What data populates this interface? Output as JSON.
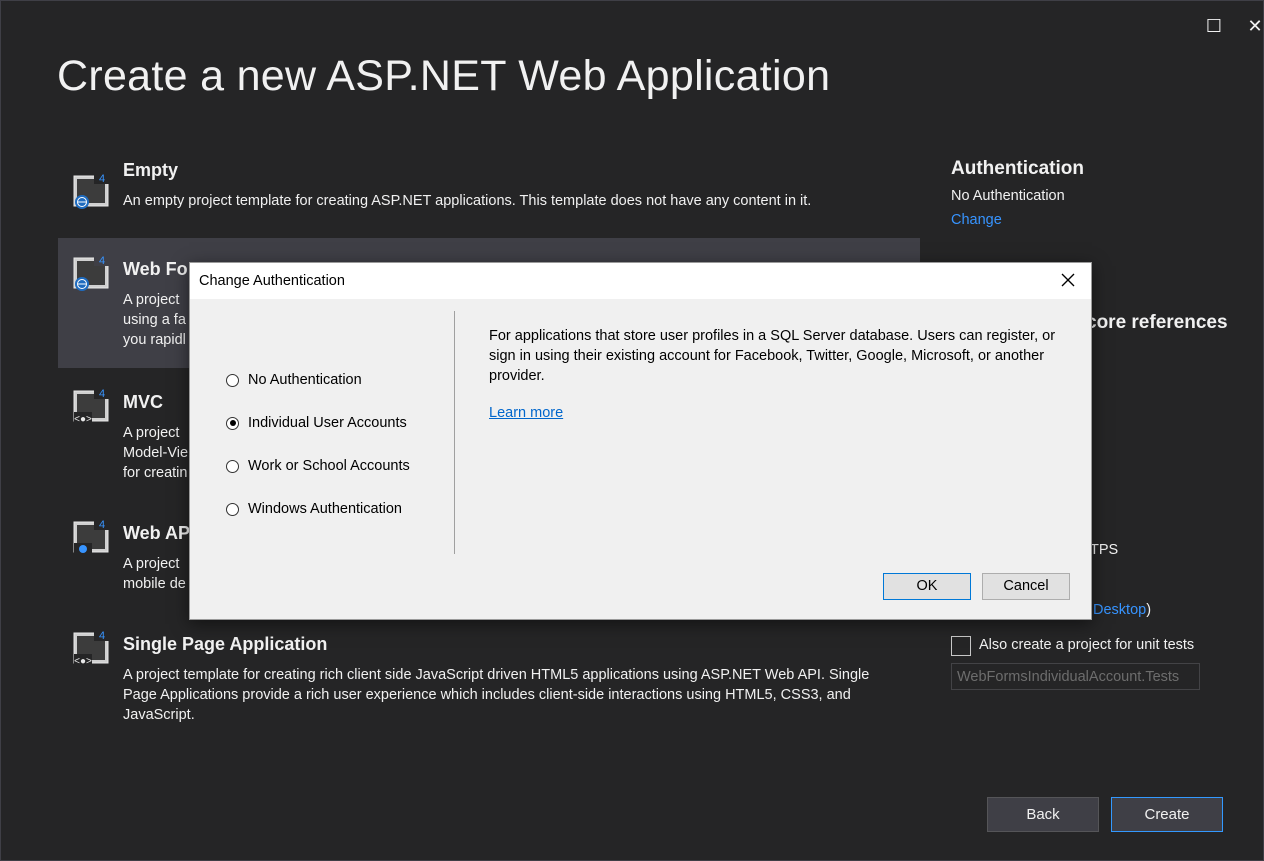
{
  "page": {
    "title": "Create a new ASP.NET Web Application"
  },
  "window_controls": {
    "maximize_glyph": "☐",
    "close_glyph": "✕"
  },
  "templates": [
    {
      "name": "Empty",
      "description": "An empty project template for creating ASP.NET applications. This template does not have any content in it.",
      "icon": "web-forms-icon"
    },
    {
      "name": "Web Fo",
      "description": "A project using a fa you rapidl",
      "desc_lines": [
        "A project",
        "using a fa",
        "you rapidl"
      ],
      "icon": "web-forms-icon",
      "selected": true
    },
    {
      "name": "MVC",
      "desc_lines": [
        "A project",
        "Model-Vie",
        "for creatin"
      ],
      "icon": "mvc-icon"
    },
    {
      "name": "Web AP",
      "desc_lines": [
        "A project",
        "mobile de"
      ],
      "icon": "web-api-icon"
    },
    {
      "name": "Single Page Application",
      "description": "A project template for creating rich client side JavaScript driven HTML5 applications using ASP.NET Web API. Single Page Applications provide a rich user experience which includes client-side interactions using HTML5, CSS3, and JavaScript.",
      "icon": "spa-icon"
    }
  ],
  "right_panel": {
    "auth_heading": "Authentication",
    "auth_value": "No Authentication",
    "change_link": "Change",
    "core_refs_fragment": "core references",
    "https_fragment": "TPS",
    "desktop_link": "Desktop",
    "desktop_paren": ")",
    "unit_tests_label": "Also create a project for unit tests",
    "unit_tests_checked": false,
    "tests_project_name": "WebFormsIndividualAccount.Tests"
  },
  "footer": {
    "back_label": "Back",
    "create_label": "Create"
  },
  "dialog": {
    "title": "Change Authentication",
    "options": [
      {
        "label": "No Authentication",
        "checked": false
      },
      {
        "label": "Individual User Accounts",
        "checked": true
      },
      {
        "label": "Work or School Accounts",
        "checked": false
      },
      {
        "label": "Windows Authentication",
        "checked": false
      }
    ],
    "description": "For applications that store user profiles in a SQL Server database. Users can register, or sign in using their existing account for Facebook, Twitter, Google, Microsoft, or another provider.",
    "learn_more": "Learn more",
    "ok_label": "OK",
    "cancel_label": "Cancel"
  },
  "colors": {
    "background": "#252526",
    "selected_row": "#3f3f46",
    "link": "#3794ff",
    "accent_border": "#3399ff",
    "dialog_background": "#f0f0f0"
  }
}
